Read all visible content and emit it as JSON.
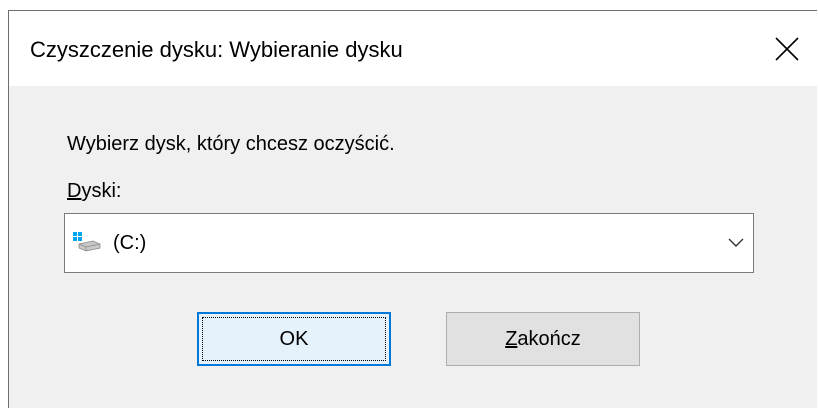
{
  "window": {
    "title": "Czyszczenie dysku: Wybieranie dysku"
  },
  "dialog": {
    "instruction": "Wybierz dysk, który chcesz oczyścić.",
    "drives_label_mnemonic": "D",
    "drives_label_rest": "yski:",
    "drives_combo": {
      "selected_value": "(C:)",
      "icon": "hard-drive-icon"
    },
    "ok_label": "OK",
    "cancel_label_mnemonic": "Z",
    "cancel_label_rest": "akończ"
  },
  "icons": {
    "close": "close-icon",
    "dropdown": "chevron-down-icon"
  },
  "colors": {
    "accent": "#0078d7",
    "dialog_bg": "#f0f0f0",
    "titlebar_bg": "#ffffff",
    "button_bg": "#e1e1e1"
  }
}
